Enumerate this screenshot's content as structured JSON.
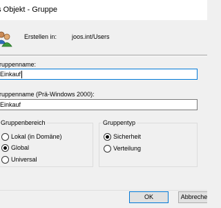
{
  "window": {
    "title": "es Objekt - Gruppe"
  },
  "header": {
    "icon": "users-group-icon",
    "create_in_label": "Erstellen in:",
    "create_in_value": "joos.int/Users"
  },
  "form": {
    "group_name_label": "ruppenname:",
    "group_name_value": "Einkauf",
    "group_name_pre2000_label": "ruppenname (Prä-Windows 2000):",
    "group_name_pre2000_value": "Einkauf"
  },
  "group_scope": {
    "title": "Gruppenbereich",
    "options": [
      {
        "label": "Lokal (in Domäne)",
        "checked": false
      },
      {
        "label": "Global",
        "checked": true
      },
      {
        "label": "Universal",
        "checked": false
      }
    ]
  },
  "group_type": {
    "title": "Gruppentyp",
    "options": [
      {
        "label": "Sicherheit",
        "checked": true
      },
      {
        "label": "Verteilung",
        "checked": false
      }
    ]
  },
  "buttons": {
    "ok_label": "OK",
    "cancel_label": "Abbreche"
  },
  "colors": {
    "focus_border": "#0078d7",
    "dialog_background": "#f0f0f0"
  }
}
